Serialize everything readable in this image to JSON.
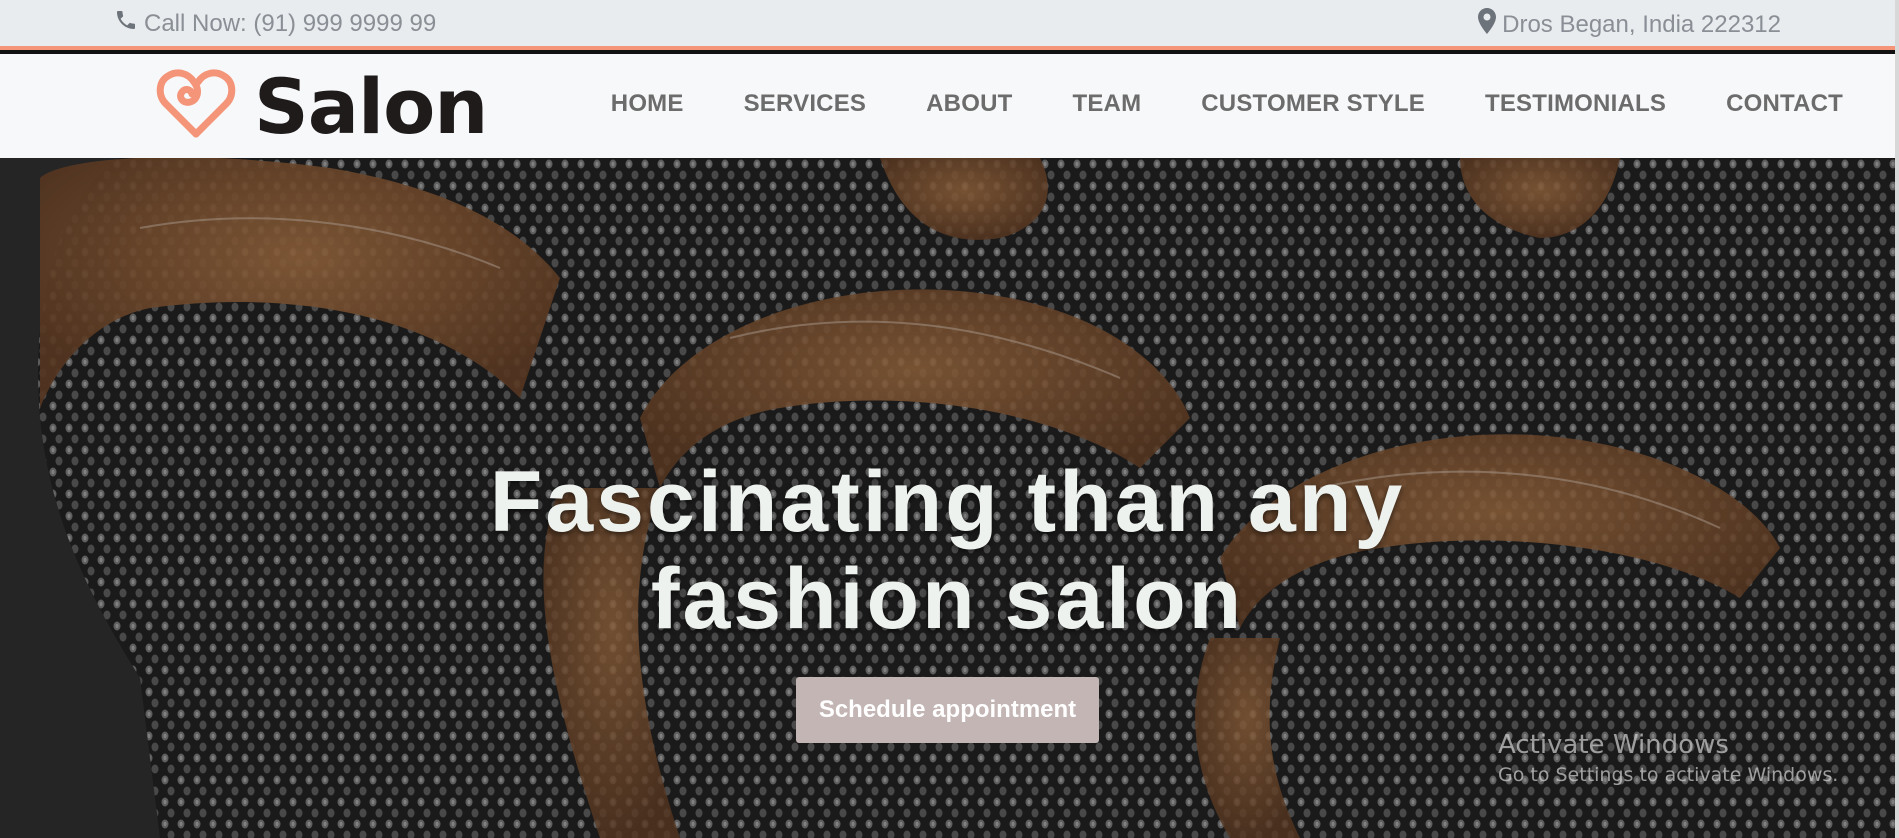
{
  "topbar": {
    "phone_icon": "phone-icon",
    "phone_text": "Call Now: (91) 999 9999 99",
    "location_icon": "map-pin-icon",
    "address_text": "Dros Began, India 222312"
  },
  "brand": {
    "logo_icon": "heart-logo-icon",
    "name": "Salon"
  },
  "nav": {
    "items": [
      "HOME",
      "SERVICES",
      "ABOUT",
      "TEAM",
      "CUSTOMER STYLE",
      "TESTIMONIALS",
      "CONTACT"
    ]
  },
  "hero": {
    "headline_line1": "Fascinating than any",
    "headline_line2": "fashion salon",
    "cta_label": "Schedule appointment"
  },
  "watermark": {
    "title": "Activate Windows",
    "subtitle": "Go to Settings to activate Windows."
  },
  "colors": {
    "accent": "#f4957a",
    "topbar_bg": "#e9ecef",
    "navbar_bg": "#f7f8fa",
    "cta_bg": "#c2b5b3",
    "nav_text": "#6c6c6c"
  }
}
